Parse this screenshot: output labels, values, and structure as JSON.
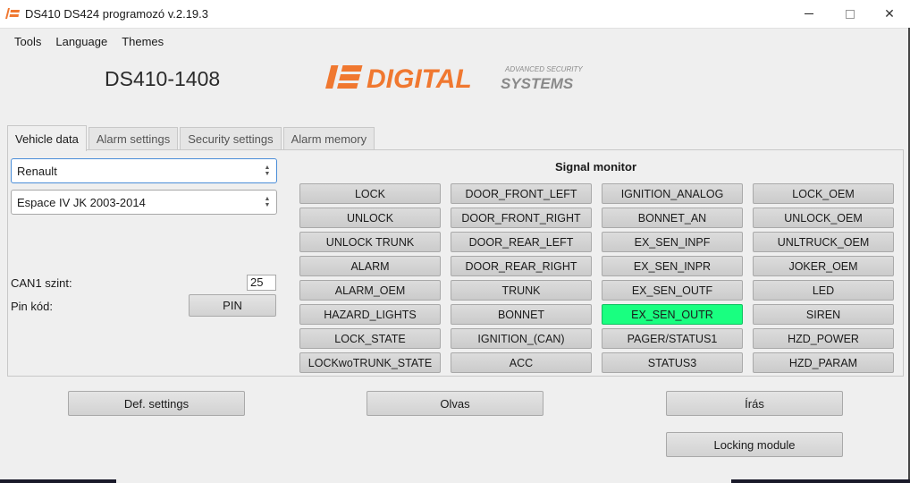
{
  "window": {
    "title": "DS410 DS424 programozó v.2.19.3",
    "minimize_glyph": "—",
    "close_glyph": "✕"
  },
  "menu": {
    "items": [
      "Tools",
      "Language",
      "Themes"
    ]
  },
  "device_title": "DS410-1408",
  "logo": {
    "brand": "DIGITAL",
    "tagline": "ADVANCED SECURITY",
    "systems": "SYSTEMS",
    "accent_color": "#f07830",
    "gray_color": "#8a8a8a"
  },
  "tabs": [
    {
      "label": "Vehicle data",
      "active": true
    },
    {
      "label": "Alarm settings",
      "active": false
    },
    {
      "label": "Security settings",
      "active": false
    },
    {
      "label": "Alarm memory",
      "active": false
    }
  ],
  "vehicle": {
    "make": "Renault",
    "model": "Espace IV JK 2003-2014",
    "can1_label": "CAN1 szint:",
    "can1_value": "25",
    "pin_label": "Pin kód:",
    "pin_button": "PIN"
  },
  "signal_monitor": {
    "title": "Signal monitor",
    "active_color": "#19ff80",
    "rows": [
      [
        "LOCK",
        "DOOR_FRONT_LEFT",
        "IGNITION_ANALOG",
        "LOCK_OEM"
      ],
      [
        "UNLOCK",
        "DOOR_FRONT_RIGHT",
        "BONNET_AN",
        "UNLOCK_OEM"
      ],
      [
        "UNLOCK TRUNK",
        "DOOR_REAR_LEFT",
        "EX_SEN_INPF",
        "UNLTRUCK_OEM"
      ],
      [
        "ALARM",
        "DOOR_REAR_RIGHT",
        "EX_SEN_INPR",
        "JOKER_OEM"
      ],
      [
        "ALARM_OEM",
        "TRUNK",
        "EX_SEN_OUTF",
        "LED"
      ],
      [
        "HAZARD_LIGHTS",
        "BONNET",
        "EX_SEN_OUTR",
        "SIREN"
      ],
      [
        "LOCK_STATE",
        "IGNITION_(CAN)",
        "PAGER/STATUS1",
        "HZD_POWER"
      ],
      [
        "LOCKwoTRUNK_STATE",
        "ACC",
        "STATUS3",
        "HZD_PARAM"
      ]
    ],
    "active_signals": [
      "EX_SEN_OUTR"
    ]
  },
  "actions": {
    "def_settings": "Def. settings",
    "read": "Olvas",
    "write": "Írás",
    "locking_module": "Locking module"
  }
}
